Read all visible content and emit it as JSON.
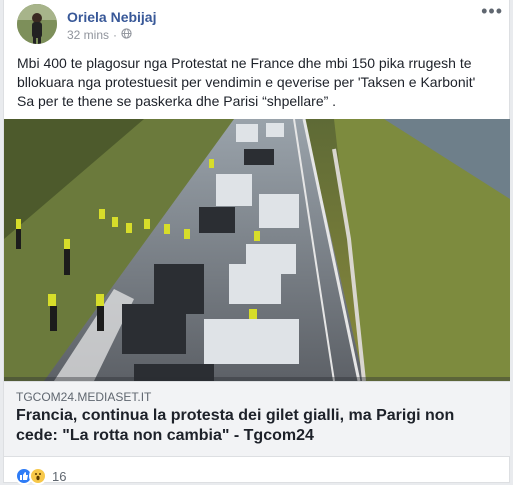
{
  "post": {
    "author": "Oriela Nebijaj",
    "time": "32 mins",
    "privacy_icon": "globe-icon",
    "text_line1": "Mbi 400 te plagosur nga Protestat ne France dhe mbi 150 pika rrugesh te",
    "text_line2": "bllokuara nga protestuesit per vendimin e qeverise per 'Taksen e Karbonit'",
    "text_line3": "Sa per te thene se paskerka dhe Parisi “shpellare” ."
  },
  "link": {
    "domain": "TGCOM24.MEDIASET.IT",
    "headline": "Francia, continua la protesta dei gilet gialli, ma Parigi non cede: \"La rotta non cambia\" - Tgcom24"
  },
  "reactions": {
    "count": "16",
    "types": [
      "like",
      "wow"
    ]
  },
  "colors": {
    "author": "#385898",
    "link_bg": "#f2f3f5",
    "like": "#2e7cf6",
    "wow": "#f7c84a"
  }
}
